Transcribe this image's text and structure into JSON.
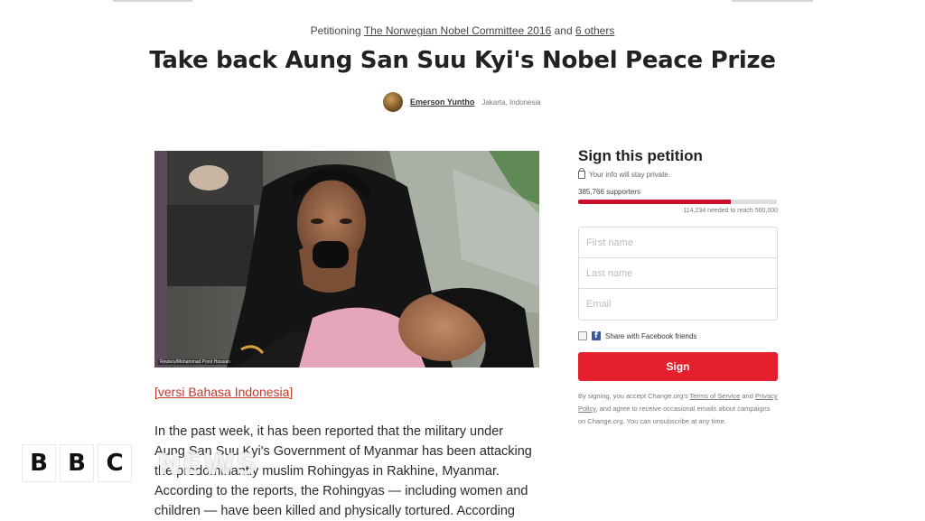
{
  "header": {
    "petitioning_prefix": "Petitioning",
    "petitioning_target": "The Norwegian Nobel Committee 2016",
    "petitioning_and": "and",
    "petitioning_others": "6 others"
  },
  "petition": {
    "title": "Take back Aung San Suu Kyi's Nobel Peace Prize",
    "author_name": "Emerson Yuntho",
    "author_location": "Jakarta, Indonesia",
    "photo_credit": "Reuters/Mohammad Ponir Hossain",
    "language_link": "[versi Bahasa Indonesia]",
    "body_lines": [
      "In the past week, it has been reported that the military under",
      "Aung San Suu Kyi's Government of Myanmar has been attacking",
      "the predominantly muslim Rohingyas in Rakhine, Myanmar.",
      "According to the reports, the Rohingyas — including women and",
      "children — have been killed and physically tortured. According"
    ]
  },
  "sidebar": {
    "sign_title": "Sign this petition",
    "privacy_text": "Your info will stay private.",
    "supporters_text": "385,766 supporters",
    "progress_fraction": 0.77,
    "needed_text": "114,234 needed to reach 500,000",
    "first_name_placeholder": "First name",
    "last_name_placeholder": "Last name",
    "email_placeholder": "Email",
    "facebook_share_label": "Share with Facebook friends",
    "sign_button_label": "Sign",
    "legal_prefix": "By signing, you accept Change.org's",
    "legal_terms": "Terms of Service",
    "legal_and": "and",
    "legal_privacy": "Privacy Policy",
    "legal_suffix": ", and agree to receive occasional emails about campaigns on Change.org. You can unsubscribe at any time."
  },
  "watermark": {
    "bbc_letters": [
      "B",
      "B",
      "C"
    ],
    "news_text": "NEWS"
  },
  "colors": {
    "accent_red": "#e4202f",
    "progress_red": "#c8102e",
    "link_red": "#c0392b",
    "facebook_blue": "#3b5998"
  }
}
